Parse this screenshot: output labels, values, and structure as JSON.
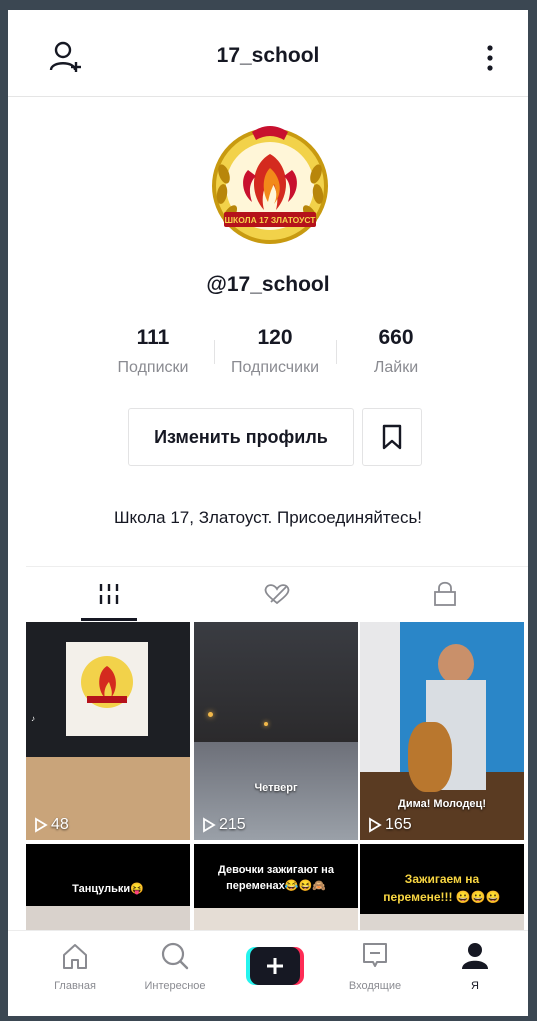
{
  "header": {
    "title": "17_school"
  },
  "profile": {
    "username": "@17_school",
    "logo_text": "ШКОЛА 17 ЗЛАТОУСТ",
    "stats": [
      {
        "value": "111",
        "label": "Подписки"
      },
      {
        "value": "120",
        "label": "Подписчики"
      },
      {
        "value": "660",
        "label": "Лайки"
      }
    ],
    "edit_label": "Изменить профиль",
    "bio": "Школа 17, Златоуст. Присоединяйтесь!"
  },
  "videos": [
    {
      "caption": "",
      "plays": "48"
    },
    {
      "caption": "Четверг",
      "plays": "215"
    },
    {
      "caption": "Дима! Молодец!",
      "plays": "165"
    },
    {
      "caption": "Танцульки😝",
      "plays": ""
    },
    {
      "caption": "Девочки зажигают на переменах😂😆🙈",
      "plays": ""
    },
    {
      "caption": "Зажигаем на перемене!!! 😀😀😀",
      "plays": ""
    }
  ],
  "nav": {
    "items": [
      {
        "label": "Главная",
        "icon": "home-icon"
      },
      {
        "label": "Интересное",
        "icon": "search-icon"
      },
      {
        "label": "",
        "icon": "plus-icon"
      },
      {
        "label": "Входящие",
        "icon": "inbox-icon"
      },
      {
        "label": "Я",
        "icon": "profile-icon"
      }
    ]
  },
  "colors": {
    "text": "#161823",
    "muted": "#8a8b91",
    "pink": "#fe2c55",
    "cyan": "#25f4ee",
    "gold": "#d4a017",
    "red": "#c8102e"
  }
}
